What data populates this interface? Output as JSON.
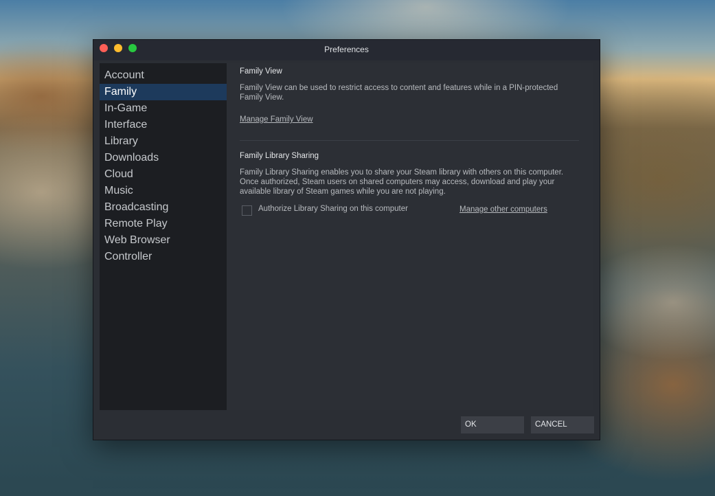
{
  "window": {
    "title": "Preferences",
    "traffic_lights": [
      "close",
      "minimize",
      "maximize"
    ]
  },
  "sidebar": {
    "active": "Family",
    "items": [
      {
        "label": "Account"
      },
      {
        "label": "Family"
      },
      {
        "label": "In-Game"
      },
      {
        "label": "Interface"
      },
      {
        "label": "Library"
      },
      {
        "label": "Downloads"
      },
      {
        "label": "Cloud"
      },
      {
        "label": "Music"
      },
      {
        "label": "Broadcasting"
      },
      {
        "label": "Remote Play"
      },
      {
        "label": "Web Browser"
      },
      {
        "label": "Controller"
      }
    ]
  },
  "family_view": {
    "title": "Family View",
    "description": "Family View can be used to restrict access to content and features while in a PIN-protected Family View.",
    "manage_link": "Manage Family View"
  },
  "library_sharing": {
    "title": "Family Library Sharing",
    "description": "Family Library Sharing enables you to share your Steam library with others on this computer. Once authorized, Steam users on shared computers may access, download and play your available library of Steam games while you are not playing.",
    "authorize_label": "Authorize Library Sharing on this computer",
    "authorize_checked": false,
    "manage_link": "Manage other computers"
  },
  "footer": {
    "ok_label": "OK",
    "cancel_label": "CANCEL"
  }
}
